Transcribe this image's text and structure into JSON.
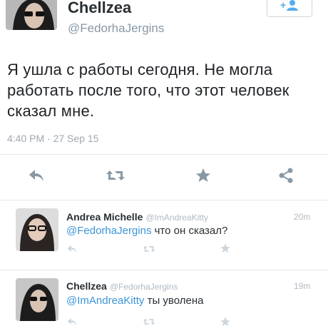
{
  "tweet": {
    "display_name": "Chellzea",
    "handle": "@FedorhaJergins",
    "text": "Я ушла с работы сегодня. Не могла работать после того, что этот человек сказал мне.",
    "timestamp": "4:40 PM · 27 Sep 15",
    "follow_icon": "person-plus-icon",
    "actions": [
      "reply-icon",
      "retweet-icon",
      "favorite-icon",
      "share-icon"
    ]
  },
  "replies": [
    {
      "display_name": "Andrea Michelle",
      "handle": "@ImAndreaKitty",
      "time": "20m",
      "mention": "@FedorhaJergins",
      "text": " что он сказал?"
    },
    {
      "display_name": "Chellzea",
      "handle": "@FedorhaJergins",
      "time": "19m",
      "mention": "@ImAndreaKitty",
      "text": " ты уволена"
    }
  ],
  "colors": {
    "accent": "#55acee",
    "icon_gray": "#8899a6",
    "light_icon": "#ccd6dd",
    "link": "#3b94d9"
  }
}
